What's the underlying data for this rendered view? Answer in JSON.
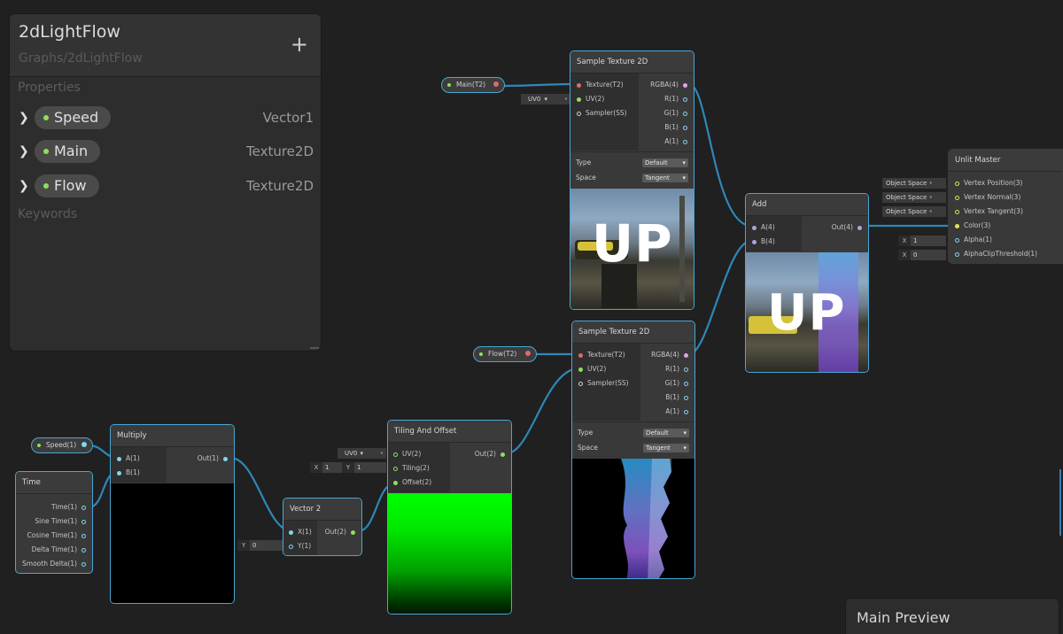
{
  "blackboard": {
    "title": "2dLightFlow",
    "subtitle": "Graphs/2dLightFlow",
    "add_label": "+",
    "properties_label": "Properties",
    "keywords_label": "Keywords",
    "properties": [
      {
        "name": "Speed",
        "type": "Vector1"
      },
      {
        "name": "Main",
        "type": "Texture2D"
      },
      {
        "name": "Flow",
        "type": "Texture2D"
      }
    ],
    "chevron": "›"
  },
  "nodes": {
    "sample1": {
      "title": "Sample Texture 2D",
      "in": [
        "Texture(T2)",
        "UV(2)",
        "Sampler(SS)"
      ],
      "out": [
        "RGBA(4)",
        "R(1)",
        "G(1)",
        "B(1)",
        "A(1)"
      ],
      "type_label": "Type",
      "type_value": "Default",
      "space_label": "Space",
      "space_value": "Tangent",
      "preview_text": "UP"
    },
    "sample2": {
      "title": "Sample Texture 2D",
      "in": [
        "Texture(T2)",
        "UV(2)",
        "Sampler(SS)"
      ],
      "out": [
        "RGBA(4)",
        "R(1)",
        "G(1)",
        "B(1)",
        "A(1)"
      ],
      "type_label": "Type",
      "type_value": "Default",
      "space_label": "Space",
      "space_value": "Tangent"
    },
    "add": {
      "title": "Add",
      "in": [
        "A(4)",
        "B(4)"
      ],
      "out": [
        "Out(4)"
      ],
      "preview_text": "UP"
    },
    "master": {
      "title": "Unlit Master",
      "in": [
        "Vertex Position(3)",
        "Vertex Normal(3)",
        "Vertex Tangent(3)",
        "Color(3)",
        "Alpha(1)",
        "AlphaClipThreshold(1)"
      ]
    },
    "multiply": {
      "title": "Multiply",
      "in": [
        "A(1)",
        "B(1)"
      ],
      "out": [
        "Out(1)"
      ]
    },
    "time": {
      "title": "Time",
      "out": [
        "Time(1)",
        "Sine Time(1)",
        "Cosine Time(1)",
        "Delta Time(1)",
        "Smooth Delta(1)"
      ]
    },
    "vector2": {
      "title": "Vector 2",
      "in": [
        "X(1)",
        "Y(1)"
      ],
      "out": [
        "Out(2)"
      ]
    },
    "tiling": {
      "title": "Tiling And Offset",
      "in": [
        "UV(2)",
        "Tiling(2)",
        "Offset(2)"
      ],
      "out": [
        "Out(2)"
      ]
    }
  },
  "props": {
    "main": "Main(T2)",
    "flow": "Flow(T2)",
    "speed": "Speed(1)"
  },
  "inputs": {
    "uv0": "UV0",
    "object_space": "Object Space",
    "x_label": "X",
    "y_label": "Y",
    "alpha_value": "1",
    "clip_value": "0",
    "tiling_x": "1",
    "tiling_y": "1",
    "vector_y": "0"
  },
  "main_preview": {
    "title": "Main Preview"
  },
  "colors": {
    "wire": "#2f87b8",
    "node_border": "#4aa6d4",
    "texture_port": "#e06a6a",
    "vector_port": "#8ce05a",
    "float_port": "#84d4f0"
  }
}
